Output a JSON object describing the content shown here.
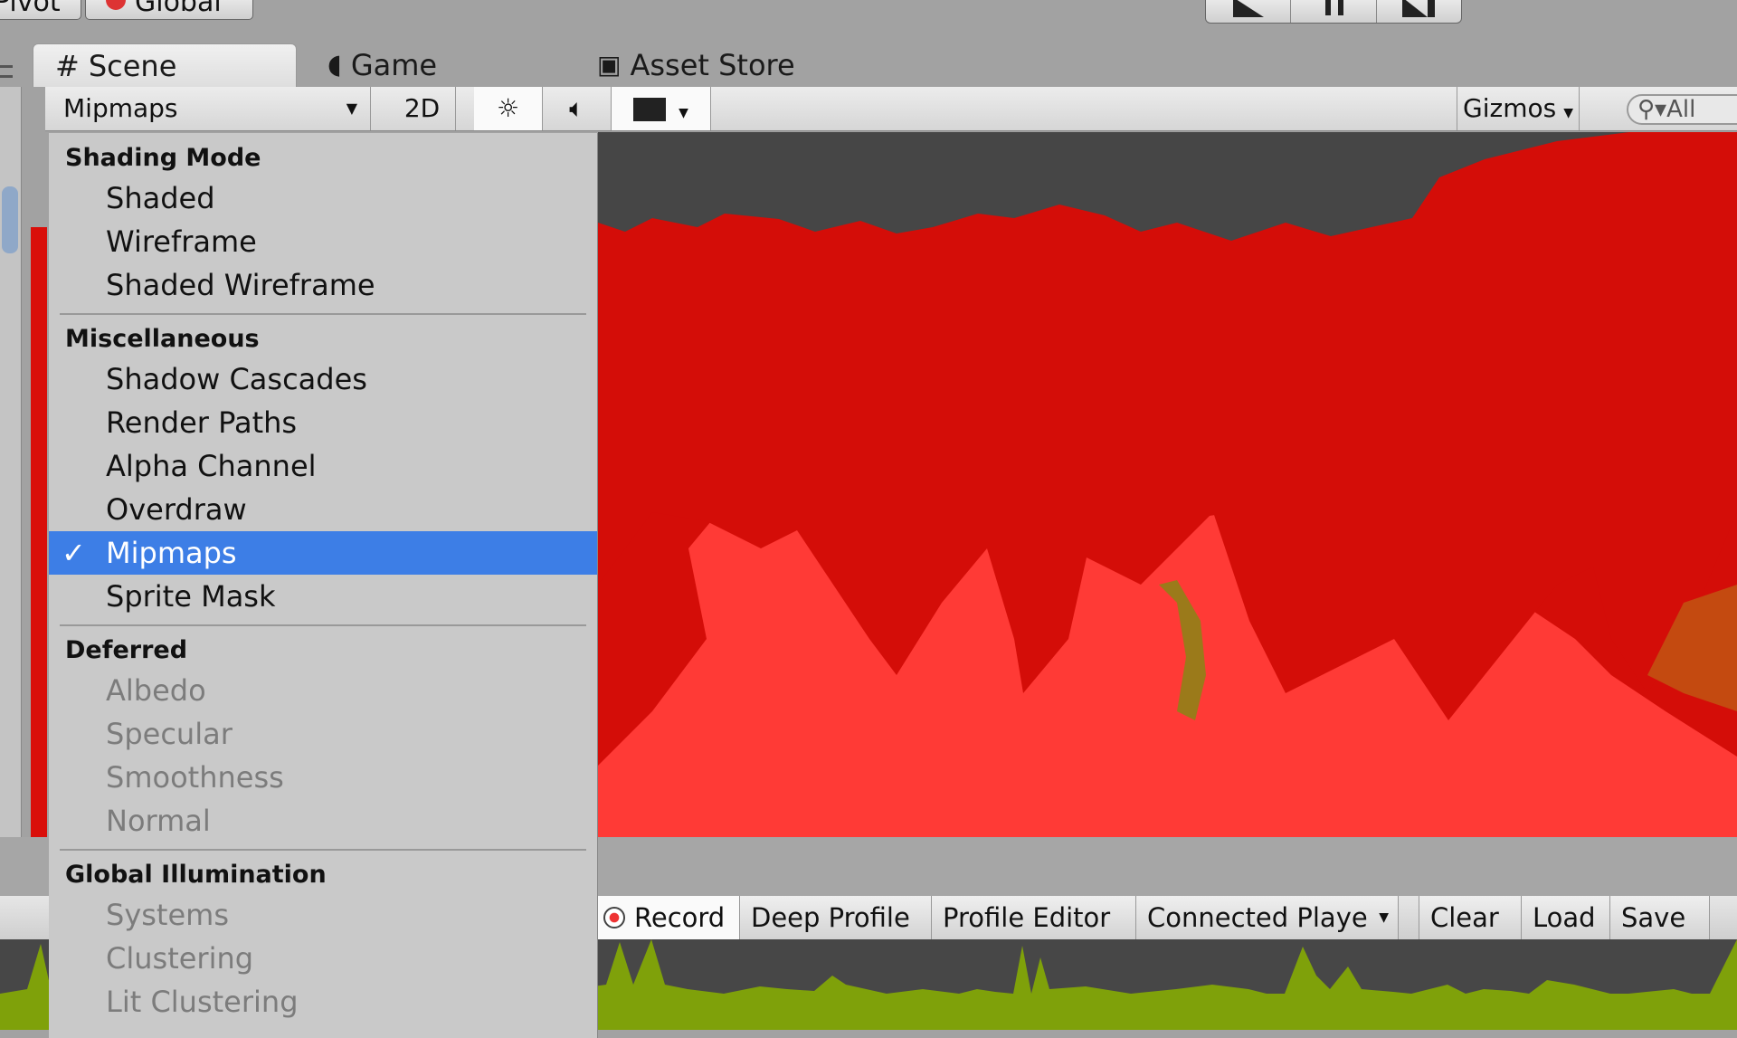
{
  "top": {
    "pivot_label": "Pivot",
    "global_label": "Global"
  },
  "tabs": [
    {
      "label": "Scene",
      "icon": "grid-icon"
    },
    {
      "label": "Game",
      "icon": "pacman-icon"
    },
    {
      "label": "Asset Store",
      "icon": "bag-icon"
    }
  ],
  "scene_toolbar": {
    "draw_mode": "Mipmaps",
    "mode_2d": "2D",
    "gizmos": "Gizmos",
    "search_placeholder": "All"
  },
  "menu": {
    "sections": [
      {
        "header": "Shading Mode",
        "items": [
          {
            "label": "Shaded"
          },
          {
            "label": "Wireframe"
          },
          {
            "label": "Shaded Wireframe"
          }
        ]
      },
      {
        "header": "Miscellaneous",
        "items": [
          {
            "label": "Shadow Cascades"
          },
          {
            "label": "Render Paths"
          },
          {
            "label": "Alpha Channel"
          },
          {
            "label": "Overdraw"
          },
          {
            "label": "Mipmaps",
            "selected": true
          },
          {
            "label": "Sprite Mask"
          }
        ]
      },
      {
        "header": "Deferred",
        "items": [
          {
            "label": "Albedo",
            "disabled": true
          },
          {
            "label": "Specular",
            "disabled": true
          },
          {
            "label": "Smoothness",
            "disabled": true
          },
          {
            "label": "Normal",
            "disabled": true
          }
        ]
      },
      {
        "header": "Global Illumination",
        "items": [
          {
            "label": "Systems",
            "disabled": true
          },
          {
            "label": "Clustering",
            "disabled": true
          },
          {
            "label": "Lit Clustering",
            "disabled": true
          }
        ]
      }
    ],
    "checkmark": "✓"
  },
  "profiler": {
    "record": "Record",
    "deep_profile": "Deep Profile",
    "profile_editor": "Profile Editor",
    "connected_player": "Connected Playe",
    "clear": "Clear",
    "load": "Load",
    "save": "Save"
  },
  "colors": {
    "selection": "#3d7ee6",
    "mipmap_red": "#d40d08",
    "mipmap_light_red": "#ff3a36",
    "graph_green": "#7fa10a",
    "viewport_bg": "#464646"
  }
}
